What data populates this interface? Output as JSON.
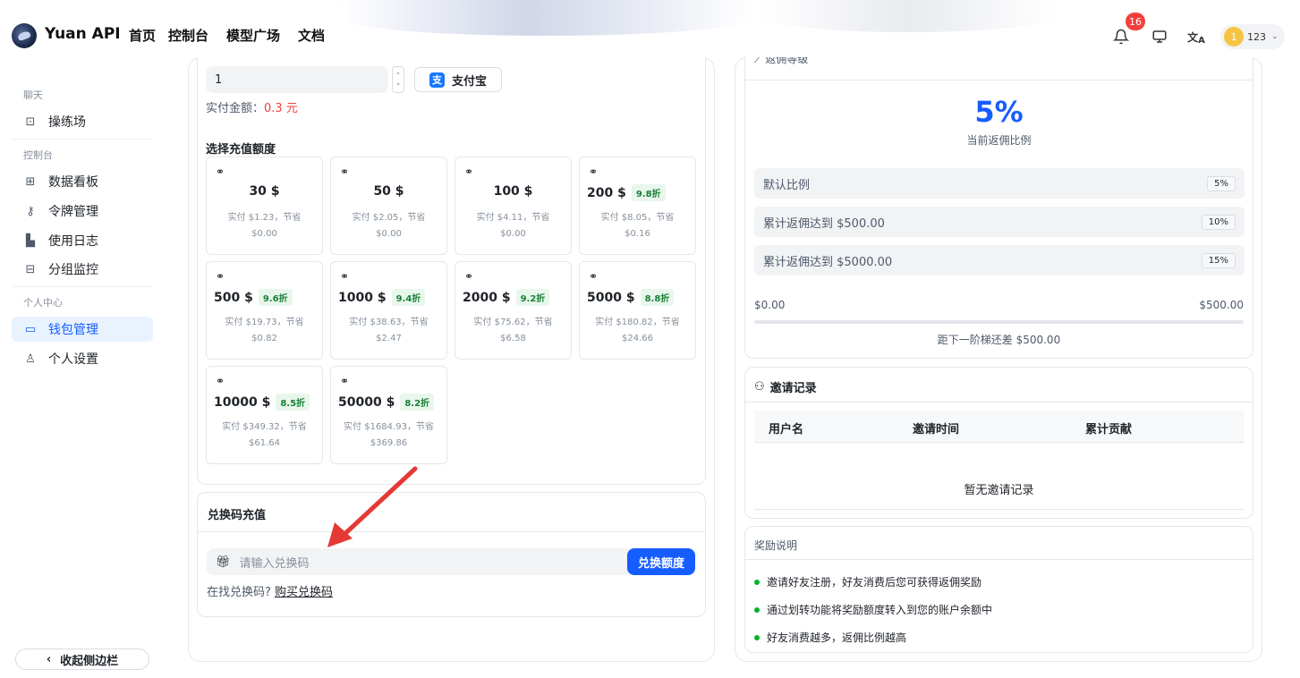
{
  "header": {
    "brand": "Yuan API",
    "nav": [
      "首页",
      "控制台",
      "模型广场",
      "文档"
    ],
    "notification_count": "16",
    "user_avatar_text": "1",
    "user_name": "123"
  },
  "sidebar": {
    "section_chat": "聊天",
    "playground": "操练场",
    "section_console": "控制台",
    "dashboard": "数据看板",
    "tokens": "令牌管理",
    "logs": "使用日志",
    "group_monitor": "分组监控",
    "section_personal": "个人中心",
    "wallet": "钱包管理",
    "settings": "个人设置",
    "collapse": "收起侧边栏"
  },
  "topup": {
    "amount_value": "1",
    "alipay_label": "支付宝",
    "pay_label": "实付金额：",
    "pay_value": "0.3 元",
    "section_title": "选择充值额度",
    "options": [
      {
        "amount": "30 $",
        "discount": "",
        "desc1": "实付 $1.23，节省",
        "desc2": "$0.00"
      },
      {
        "amount": "50 $",
        "discount": "",
        "desc1": "实付 $2.05，节省",
        "desc2": "$0.00"
      },
      {
        "amount": "100 $",
        "discount": "",
        "desc1": "实付 $4.11，节省",
        "desc2": "$0.00"
      },
      {
        "amount": "200 $",
        "discount": "9.8折",
        "desc1": "实付 $8.05，节省",
        "desc2": "$0.16"
      },
      {
        "amount": "500 $",
        "discount": "9.6折",
        "desc1": "实付 $19.73，节省",
        "desc2": "$0.82"
      },
      {
        "amount": "1000 $",
        "discount": "9.4折",
        "desc1": "实付 $38.63，节省",
        "desc2": "$2.47"
      },
      {
        "amount": "2000 $",
        "discount": "9.2折",
        "desc1": "实付 $75.62，节省",
        "desc2": "$6.58"
      },
      {
        "amount": "5000 $",
        "discount": "8.8折",
        "desc1": "实付 $180.82，节省",
        "desc2": "$24.66"
      },
      {
        "amount": "10000 $",
        "discount": "8.5折",
        "desc1": "实付 $349.32，节省",
        "desc2": "$61.64"
      },
      {
        "amount": "50000 $",
        "discount": "8.2折",
        "desc1": "实付 $1684.93，节省",
        "desc2": "$369.86"
      }
    ]
  },
  "redeem": {
    "title": "兑换码充值",
    "placeholder": "请输入兑换码",
    "button": "兑换额度",
    "help_prefix": "在找兑换码?",
    "help_link": "购买兑换码"
  },
  "rebate": {
    "header": "返佣等级",
    "rate": "5%",
    "rate_label": "当前返佣比例",
    "tiers": [
      {
        "label": "默认比例",
        "tag": "5%"
      },
      {
        "label": "累计返佣达到 $500.00",
        "tag": "10%"
      },
      {
        "label": "累计返佣达到 $5000.00",
        "tag": "15%"
      }
    ],
    "progress_left": "$0.00",
    "progress_right": "$500.00",
    "progress_fraction": 0,
    "progress_note": "距下一阶梯还差 $500.00"
  },
  "invite": {
    "title": "邀请记录",
    "columns": [
      "用户名",
      "邀请时间",
      "累计贡献"
    ],
    "empty": "暂无邀请记录"
  },
  "reward": {
    "title": "奖励说明",
    "items": [
      "邀请好友注册，好友消费后您可获得返佣奖励",
      "通过划转功能将奖励额度转入到您的账户余额中",
      "好友消费越多，返佣比例越高"
    ]
  },
  "colors": {
    "accent": "#165dff",
    "badge": "#f53f3f",
    "discount_bg": "#e8f7ec",
    "discount_fg": "#1a7f37",
    "annotation_arrow": "#e53935"
  }
}
